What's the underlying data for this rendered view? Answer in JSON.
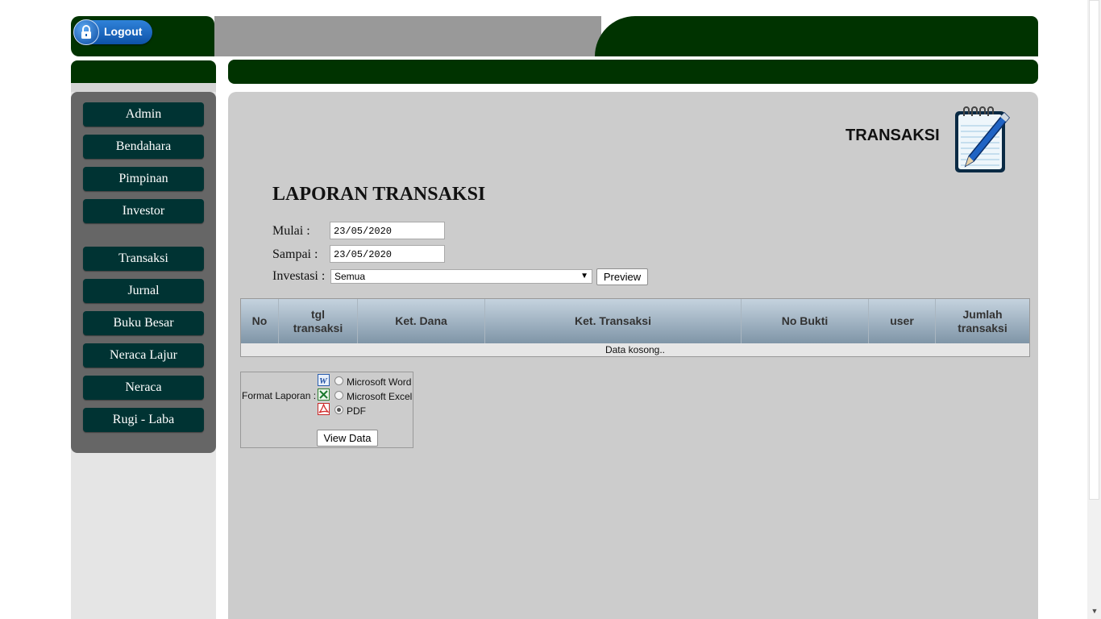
{
  "header": {
    "logout_label": "Logout"
  },
  "sidebar": {
    "items": [
      {
        "label": "Admin"
      },
      {
        "label": "Bendahara"
      },
      {
        "label": "Pimpinan"
      },
      {
        "label": "Investor"
      },
      {
        "label": "Transaksi"
      },
      {
        "label": "Jurnal"
      },
      {
        "label": "Buku Besar"
      },
      {
        "label": "Neraca Lajur"
      },
      {
        "label": "Neraca"
      },
      {
        "label": "Rugi - Laba"
      }
    ]
  },
  "main": {
    "page_heading": "TRANSAKSI",
    "report_title": "LAPORAN TRANSAKSI",
    "form": {
      "mulai_label": "Mulai :",
      "mulai_value": "23/05/2020",
      "sampai_label": "Sampai :",
      "sampai_value": "23/05/2020",
      "investasi_label": "Investasi :",
      "investasi_value": "Semua",
      "preview_label": "Preview"
    },
    "table": {
      "columns": [
        "No",
        "tgl transaksi",
        "Ket. Dana",
        "Ket. Transaksi",
        "No Bukti",
        "user",
        "Jumlah transaksi"
      ],
      "empty_text": "Data kosong.."
    },
    "format": {
      "label": "Format Laporan :",
      "options": [
        "Microsoft Word",
        "Microsoft Excel",
        "PDF"
      ],
      "selected": "PDF",
      "view_label": "View Data"
    }
  },
  "colors": {
    "header_green": "#003300",
    "menu_button": "#003333",
    "sidebar_bg": "#666666",
    "panel_bg": "#cccccc"
  }
}
